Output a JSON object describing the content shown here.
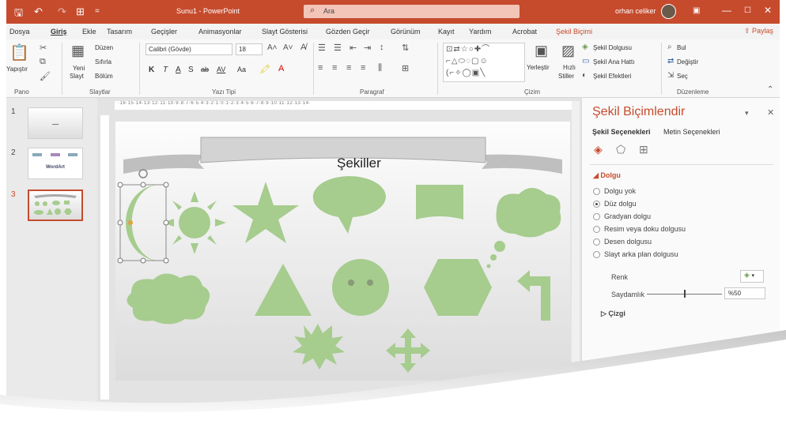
{
  "titlebar": {
    "save_icon": "save-icon",
    "undo_icon": "undo-icon",
    "redo_icon": "redo-icon",
    "present_icon": "present-from-start-icon",
    "doc_title": "Sunu1 - PowerPoint",
    "search_placeholder": "Ara",
    "user_name": "orhan celiker",
    "controls": {
      "ribbon_display": "□",
      "minimize": "—",
      "maximize": "☐",
      "close": "✕"
    }
  },
  "tabs": [
    "Dosya",
    "Giriş",
    "Ekle",
    "Tasarım",
    "Geçişler",
    "Animasyonlar",
    "Slayt Gösterisi",
    "Gözden Geçir",
    "Görünüm",
    "Kayıt",
    "Yardım",
    "Acrobat",
    "Şekil Biçimi"
  ],
  "share_label": "Paylaş",
  "ribbon": {
    "clipboard": {
      "paste": "Yapıştır",
      "group": "Pano"
    },
    "slides": {
      "new_slide_1": "Yeni",
      "new_slide_2": "Slayt",
      "layout": "Düzen",
      "reset": "Sıfırla",
      "section": "Bölüm",
      "group": "Slaytlar"
    },
    "font": {
      "family": "Calibri (Gövde)",
      "size": "18",
      "bold": "K",
      "italic": "T",
      "underline": "A",
      "shadow": "S",
      "strike": "ab",
      "spacing": "AV",
      "case": "Aa",
      "group": "Yazı Tipi"
    },
    "paragraph": {
      "group": "Paragraf"
    },
    "drawing": {
      "arrange": "Yerleştir",
      "quick_styles_1": "Hızlı",
      "quick_styles_2": "Stiller",
      "fill": "Şekil Dolgusu",
      "outline": "Şekil Ana Hattı",
      "effects": "Şekil Efektleri",
      "group": "Çizim"
    },
    "editing": {
      "find": "Bul",
      "replace": "Değiştir",
      "select": "Seç",
      "group": "Düzenleme"
    }
  },
  "slides": [
    {
      "num": "1"
    },
    {
      "num": "2",
      "label": "WordArt"
    },
    {
      "num": "3"
    }
  ],
  "ruler_text": "·16·15·14·13·12·11·10·9·8·7·6·5·4·3·2·1·0·1·2·3·4·5·6·7·8·9·10·11·12·13·14·",
  "slide": {
    "title": "Şekiller",
    "shape_color": "#a6cc8e"
  },
  "format_pane": {
    "title": "Şekil Biçimlendir",
    "tabs": [
      "Şekil Seçenekleri",
      "Metin Seçenekleri"
    ],
    "fill_header": "Dolgu",
    "options": [
      {
        "label": "Dolgu yok",
        "selected": false
      },
      {
        "label": "Düz dolgu",
        "selected": true
      },
      {
        "label": "Gradyan dolgu",
        "selected": false
      },
      {
        "label": "Resim veya doku dolgusu",
        "selected": false
      },
      {
        "label": "Desen dolgusu",
        "selected": false
      },
      {
        "label": "Slayt arka plan dolgusu",
        "selected": false
      }
    ],
    "color_label": "Renk",
    "transparency_label": "Saydamlık",
    "transparency_value": "%50",
    "transparency_fraction": 0.5,
    "line_header": "Çizgi"
  },
  "accent_color": "#c64b2d"
}
